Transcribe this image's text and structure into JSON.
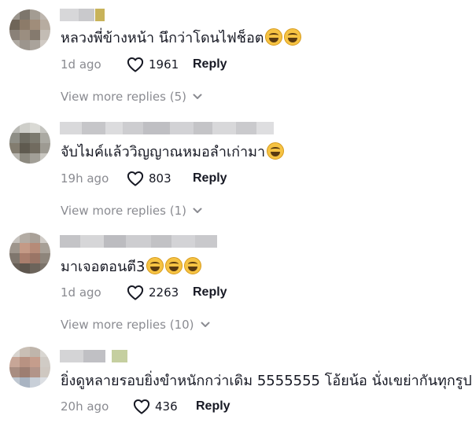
{
  "comments": [
    {
      "text": "หลวงพี่ข้างหน้า นึกว่าโดนไฟช็อต",
      "emoji_count": 2,
      "time": "1d ago",
      "likes": "1961",
      "reply_label": "Reply",
      "view_more": "View more replies (5)"
    },
    {
      "text": "จับไมค์แล้ววิญญาณหมอลำเก่ามา",
      "emoji_count": 1,
      "time": "19h ago",
      "likes": "803",
      "reply_label": "Reply",
      "view_more": "View more replies (1)"
    },
    {
      "text": "มาเจอตอนตี3",
      "emoji_count": 3,
      "time": "1d ago",
      "likes": "2263",
      "reply_label": "Reply",
      "view_more": "View more replies (10)"
    },
    {
      "text": "ยิ่งดูหลายรอบยิ่งขำหนักกว่าเดิม 5555555 โอ้ยน้อ นั่งเขย่ากันทุกรูป",
      "emoji_count": 0,
      "time": "20h ago",
      "likes": "436",
      "reply_label": "Reply"
    }
  ],
  "colors": {
    "text": "#161823",
    "muted": "#8a8b91",
    "emoji": "#f6c343"
  },
  "icons": {
    "like": "heart-outline-icon",
    "expand": "chevron-down-icon"
  }
}
